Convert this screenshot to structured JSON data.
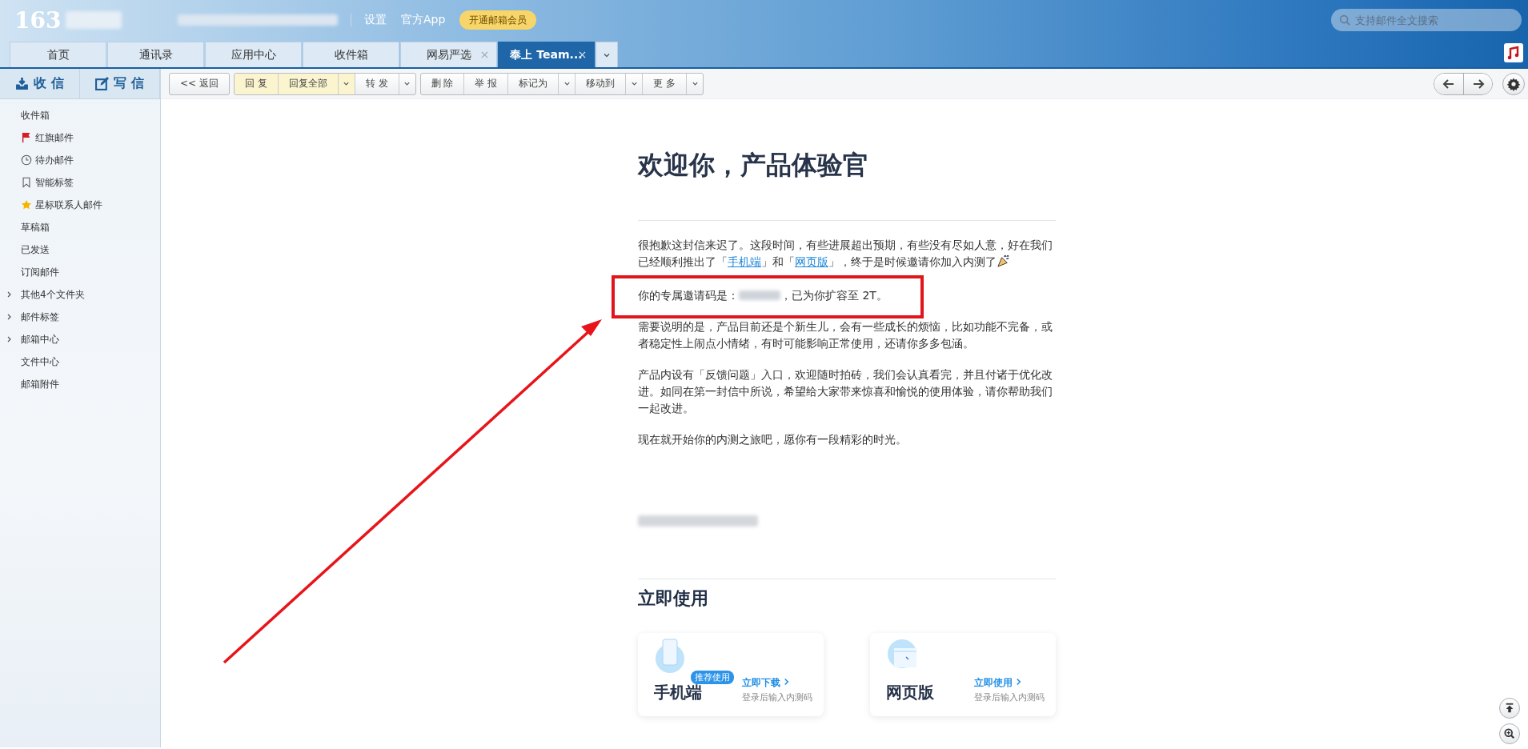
{
  "header": {
    "logo": "163",
    "links": [
      "设置",
      "官方App"
    ],
    "vip_button": "开通邮箱会员",
    "search": {
      "placeholder": "支持邮件全文搜索"
    }
  },
  "tabs": [
    {
      "label": "首页",
      "selected": false,
      "closable": false
    },
    {
      "label": "通讯录",
      "selected": false,
      "closable": false
    },
    {
      "label": "应用中心",
      "selected": false,
      "closable": false
    },
    {
      "label": "收件箱",
      "selected": false,
      "closable": false
    },
    {
      "label": "网易严选",
      "selected": false,
      "closable": true
    },
    {
      "label": "奉上 Team...",
      "selected": true,
      "closable": true
    }
  ],
  "sidebar": {
    "buttons": [
      {
        "label": "收 信",
        "kind": "receive"
      },
      {
        "label": "写 信",
        "kind": "compose"
      }
    ],
    "folders": [
      {
        "label": "收件箱",
        "kind": "plain",
        "expandable": false
      },
      {
        "label": "红旗邮件",
        "kind": "flag",
        "expandable": false
      },
      {
        "label": "待办邮件",
        "kind": "clock",
        "expandable": false
      },
      {
        "label": "智能标签",
        "kind": "bookmark",
        "expandable": false
      },
      {
        "label": "星标联系人邮件",
        "kind": "star",
        "expandable": false
      },
      {
        "label": "草稿箱",
        "kind": "plain",
        "expandable": false
      },
      {
        "label": "已发送",
        "kind": "plain",
        "expandable": false
      },
      {
        "label": "订阅邮件",
        "kind": "plain",
        "expandable": false
      },
      {
        "label": "其他4个文件夹",
        "kind": "plain",
        "expandable": true
      },
      {
        "label": "邮件标签",
        "kind": "plain",
        "expandable": true
      },
      {
        "label": "邮箱中心",
        "kind": "plain",
        "expandable": true
      },
      {
        "label": "文件中心",
        "kind": "plain",
        "expandable": false
      },
      {
        "label": "邮箱附件",
        "kind": "plain",
        "expandable": false
      }
    ]
  },
  "toolbar": [
    [
      {
        "label": "<< 返回",
        "highlighted": false,
        "dropdown": false
      }
    ],
    [
      {
        "label": "回 复",
        "highlighted": true,
        "dropdown": false
      },
      {
        "label": "回复全部",
        "highlighted": true,
        "dropdown": true
      },
      {
        "label": "转 发",
        "highlighted": false,
        "dropdown": true
      }
    ],
    [
      {
        "label": "删 除",
        "highlighted": false,
        "dropdown": false
      },
      {
        "label": "举 报",
        "highlighted": false,
        "dropdown": false
      },
      {
        "label": "标记为",
        "highlighted": false,
        "dropdown": true
      },
      {
        "label": "移动到",
        "highlighted": false,
        "dropdown": true
      },
      {
        "label": "更 多",
        "highlighted": false,
        "dropdown": true
      }
    ]
  ],
  "email": {
    "title": "欢迎你，产品体验官",
    "paragraphs": [
      [
        {
          "kind": "text",
          "text": "很抱歉这封信来迟了。这段时间，有些进展超出预期，有些没有尽如人意，好在我们已经顺利推出了「"
        },
        {
          "kind": "link",
          "text": "手机端"
        },
        {
          "kind": "text",
          "text": "」和「"
        },
        {
          "kind": "link",
          "text": "网页版"
        },
        {
          "kind": "text",
          "text": "」，终于是时候邀请你加入内测了"
        },
        {
          "kind": "icon"
        }
      ],
      [
        {
          "kind": "text",
          "text": "你的专属邀请码是："
        },
        {
          "kind": "blurred"
        },
        {
          "kind": "text",
          "text": "，已为你扩容至 2T。"
        }
      ],
      [
        {
          "kind": "text",
          "text": "需要说明的是，产品目前还是个新生儿，会有一些成长的烦恼，比如功能不完备，或者稳定性上闹点小情绪，有时可能影响正常使用，还请你多多包涵。"
        }
      ],
      [
        {
          "kind": "text",
          "text": "产品内设有「反馈问题」入口，欢迎随时拍砖，我们会认真看完，并且付诸于优化改进。如同在第一封信中所说，希望给大家带来惊喜和愉悦的使用体验，请你帮助我们一起改进。"
        }
      ],
      [
        {
          "kind": "text",
          "text": "现在就开始你的内测之旅吧，愿你有一段精彩的时光。"
        }
      ]
    ],
    "section_title": "立即使用",
    "cards": [
      {
        "kind": "phone",
        "title": "手机端",
        "badge": "推荐使用",
        "action": "立即下载",
        "note": "登录后输入内测码"
      },
      {
        "kind": "web",
        "title": "网页版",
        "action": "立即使用",
        "note": "登录后输入内测码"
      }
    ]
  }
}
